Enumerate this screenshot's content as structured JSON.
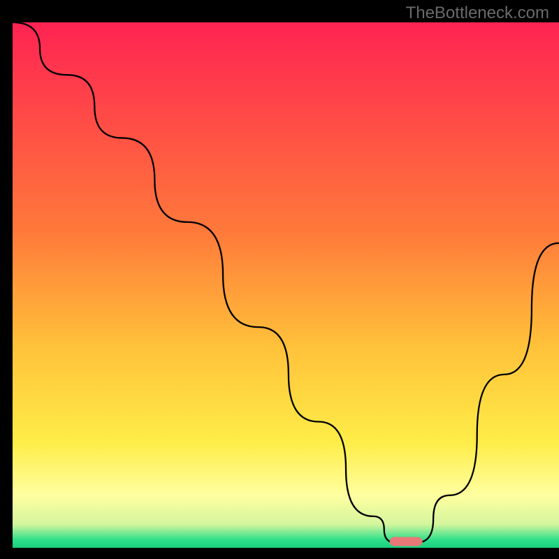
{
  "watermark": "TheBottleneck.com",
  "chart_data": {
    "type": "line",
    "title": "",
    "xlabel": "",
    "ylabel": "",
    "xlim": [
      0,
      100
    ],
    "ylim": [
      0,
      100
    ],
    "background": {
      "style": "vertical-gradient",
      "stops": [
        {
          "offset": 0.0,
          "color": "#ff2352"
        },
        {
          "offset": 0.4,
          "color": "#ff7a3a"
        },
        {
          "offset": 0.62,
          "color": "#ffc23a"
        },
        {
          "offset": 0.8,
          "color": "#feed48"
        },
        {
          "offset": 0.9,
          "color": "#ffffa0"
        },
        {
          "offset": 0.955,
          "color": "#d4f59d"
        },
        {
          "offset": 0.985,
          "color": "#2ee08a"
        },
        {
          "offset": 1.0,
          "color": "#19cf7e"
        }
      ]
    },
    "series": [
      {
        "name": "bottleneck-curve",
        "color": "#000000",
        "stroke_width": 2.3,
        "x": [
          0,
          10,
          20,
          32,
          45,
          56,
          66,
          70,
          74,
          80,
          90,
          100
        ],
        "values": [
          100,
          90,
          78,
          62,
          42,
          24,
          6,
          1,
          1,
          10,
          33,
          58
        ]
      }
    ],
    "marker": {
      "name": "optimal-point",
      "x_center": 72,
      "x_width": 6,
      "y": 1.2,
      "color": "#e87878"
    }
  }
}
